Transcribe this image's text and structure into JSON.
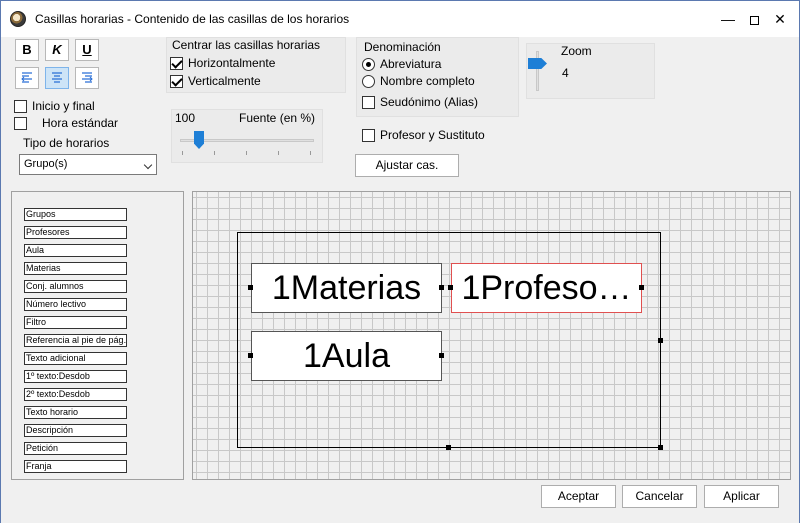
{
  "window": {
    "title": "Casillas horarias - Contenido de las casillas de los horarios",
    "minimize_label": "—",
    "close_label": "✕"
  },
  "format": {
    "bold_label": "B",
    "italic_label": "K",
    "underline_label": "U"
  },
  "options": {
    "inicio_final": "Inicio y final",
    "hora_estandar": "Hora estándar",
    "tipo_horarios_label": "Tipo de horarios",
    "tipo_horarios_value": "Grupo(s)"
  },
  "center": {
    "group_label": "Centrar las casillas horarias",
    "horizontal": "Horizontalmente",
    "vertical": "Verticalmente"
  },
  "font": {
    "value": "100",
    "label": "Fuente (en %)"
  },
  "denominacion": {
    "group_label": "Denominación",
    "abreviatura": "Abreviatura",
    "nombre_completo": "Nombre completo",
    "seudonimo": "Seudónimo (Alias)"
  },
  "profesor_sustituto": "Profesor y Sustituto",
  "ajustar_label": "Ajustar cas.",
  "zoom": {
    "label": "Zoom",
    "value": "4"
  },
  "fields": [
    "Grupos",
    "Profesores",
    "Aula",
    "Materias",
    "Conj. alumnos",
    "Número lectivo",
    "Filtro",
    "Referencia al pie de pág.",
    "Texto adicional",
    "1º texto:Desdob",
    "2º texto:Desdob",
    "Texto horario",
    "Descripción",
    "Petición",
    "Franja"
  ],
  "cells": {
    "materias": "1Materias",
    "profesores": "1Profeso…",
    "aula": "1Aula"
  },
  "buttons": {
    "aceptar": "Aceptar",
    "cancelar": "Cancelar",
    "aplicar": "Aplicar"
  }
}
